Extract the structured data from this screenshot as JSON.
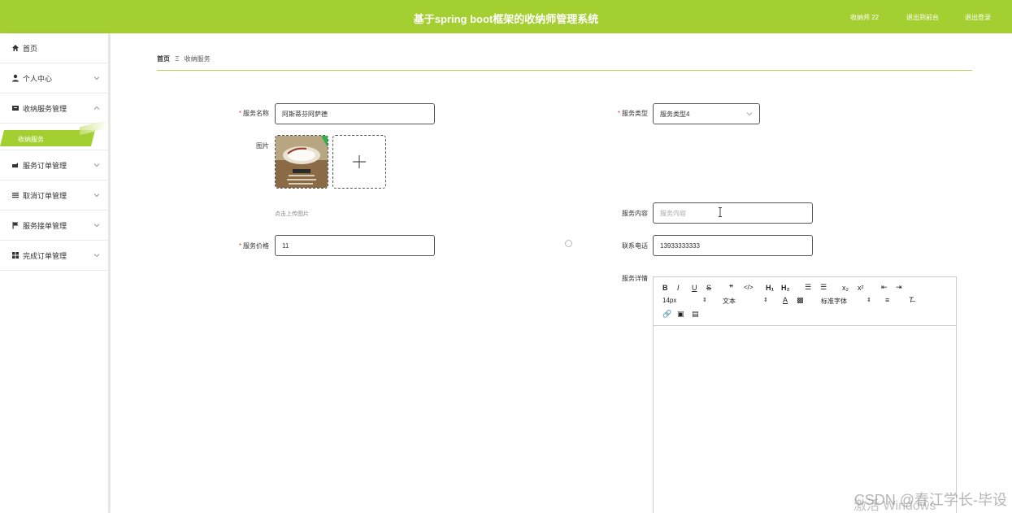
{
  "header": {
    "title": "基于spring boot框架的收纳师管理系统",
    "user": "收纳师 22",
    "back_label": "退出到前台",
    "logout_label": "退出登录",
    "accent": "#a4cf31"
  },
  "sidebar": {
    "items": [
      {
        "label": "首页",
        "icon": "home-icon"
      },
      {
        "label": "个人中心",
        "icon": "user-icon"
      },
      {
        "label": "收纳服务管理",
        "icon": "box-icon"
      },
      {
        "label": "服务订单管理",
        "icon": "cart-icon"
      },
      {
        "label": "取消订单管理",
        "icon": "list-icon"
      },
      {
        "label": "服务接单管理",
        "icon": "flag-icon"
      },
      {
        "label": "完成订单管理",
        "icon": "grid-icon"
      }
    ],
    "active_sub": "收纳服务"
  },
  "breadcrumb": {
    "home": "首页",
    "sep": "Ξ",
    "current": "收纳服务"
  },
  "form": {
    "name_label": "服务名称",
    "name_value": "阿斯蒂芬阿萨德",
    "type_label": "服务类型",
    "type_value": "服务类型4",
    "image_label": "图片",
    "upload_hint": "点击上传图片",
    "content_label": "服务内容",
    "content_placeholder": "服务内容",
    "price_label": "服务价格",
    "price_value": "11",
    "phone_label": "联系电话",
    "phone_value": "13933333333",
    "detail_label": "服务详情"
  },
  "editor": {
    "font_size": "14px",
    "block_type": "文本",
    "font_family": "标准字体"
  },
  "overlay": {
    "watermark": "CSDN @春江学长-毕设",
    "activate": "激活 Windows"
  }
}
